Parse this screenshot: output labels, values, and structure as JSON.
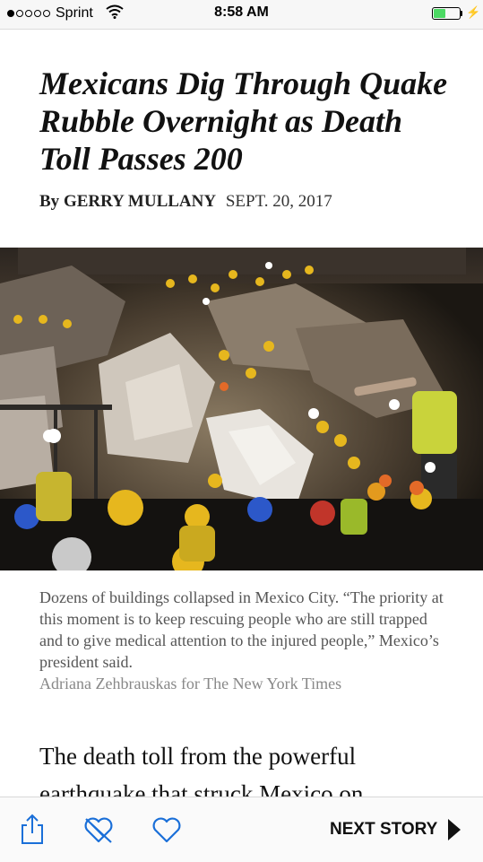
{
  "status_bar": {
    "signal_dots": 5,
    "signal_filled": 1,
    "carrier": "Sprint",
    "time": "8:58 AM",
    "battery_level": 0.45,
    "battery_color": "#4cd964",
    "icons": [
      "wifi-icon",
      "battery-icon",
      "charging-bolt-icon"
    ]
  },
  "article": {
    "headline": "Mexicans Dig Through Quake Rubble Overnight as Death Toll Passes 200",
    "byline_prefix": "By",
    "author": "GERRY MULLANY",
    "date": "SEPT. 20, 2017",
    "caption": "Dozens of buildings collapsed in Mexico City. “The priority at this moment is to keep rescuing people who are still trapped and to give medical attention to the injured people,” Mexico’s president said.",
    "credit": "Adriana Zehbrauskas for The New York Times",
    "body_first_lines": "The death toll from the powerful earthquake that struck Mexico on"
  },
  "toolbar": {
    "share_icon": "share-icon",
    "unsave_icon": "heart-crossed-icon",
    "save_icon": "heart-icon",
    "icon_color": "#1a6fd8",
    "next_story_label": "NEXT STORY",
    "next_icon": "play-arrow-icon"
  }
}
